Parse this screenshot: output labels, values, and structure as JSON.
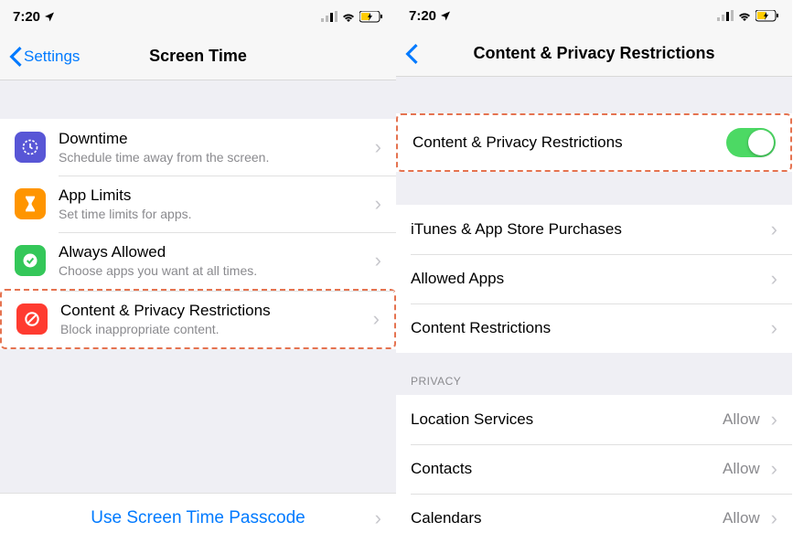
{
  "left": {
    "status": {
      "time": "7:20",
      "location_arrow": "✈"
    },
    "nav": {
      "back_label": "Settings",
      "title": "Screen Time"
    },
    "rows": [
      {
        "icon": "downtime-icon",
        "title": "Downtime",
        "subtitle": "Schedule time away from the screen."
      },
      {
        "icon": "applimits-icon",
        "title": "App Limits",
        "subtitle": "Set time limits for apps."
      },
      {
        "icon": "alwaysallowed-icon",
        "title": "Always Allowed",
        "subtitle": "Choose apps you want at all times."
      },
      {
        "icon": "contentprivacy-icon",
        "title": "Content & Privacy Restrictions",
        "subtitle": "Block inappropriate content."
      }
    ],
    "passcode": "Use Screen Time Passcode"
  },
  "right": {
    "status": {
      "time": "7:20"
    },
    "nav": {
      "title": "Content & Privacy Restrictions"
    },
    "toggle_row": {
      "label": "Content & Privacy Restrictions",
      "on": true
    },
    "rows1": [
      {
        "label": "iTunes & App Store Purchases"
      },
      {
        "label": "Allowed Apps"
      },
      {
        "label": "Content Restrictions"
      }
    ],
    "privacy_header": "PRIVACY",
    "rows2": [
      {
        "label": "Location Services",
        "value": "Allow"
      },
      {
        "label": "Contacts",
        "value": "Allow"
      },
      {
        "label": "Calendars",
        "value": "Allow"
      }
    ]
  }
}
